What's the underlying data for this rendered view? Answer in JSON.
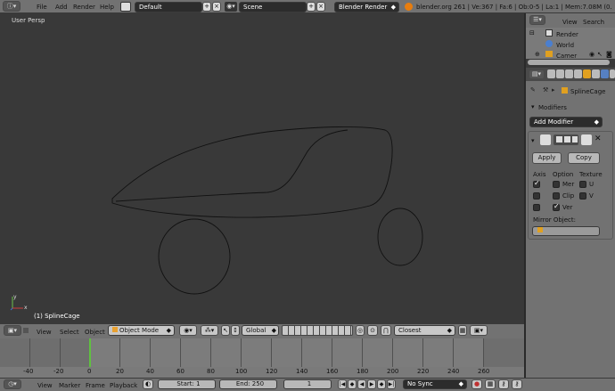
{
  "topbar": {
    "menus": [
      "File",
      "Add",
      "Render",
      "Help"
    ],
    "screen_layout": "Default",
    "scene": "Scene",
    "render_engine": "Blender Render",
    "stats": "blender.org 261 | Ve:367 | Fa:6 | Ob:0-5 | La:1 | Mem:7.08M (0.10M) | Sp"
  },
  "viewport": {
    "view_name": "User Persp",
    "object_label": "(1) SplineCage",
    "axis_y": "y",
    "axis_x": "x"
  },
  "viewport_header": {
    "menus": [
      "View",
      "Select",
      "Object"
    ],
    "mode": "Object Mode",
    "orientation": "Global",
    "snap_target": "Closest"
  },
  "timeline": {
    "ticks": [
      "-40",
      "-20",
      "0",
      "20",
      "40",
      "60",
      "80",
      "100",
      "120",
      "140",
      "160",
      "180",
      "200",
      "220",
      "240",
      "260"
    ],
    "current_frame_marker": 0,
    "menus": [
      "View",
      "Marker",
      "Frame",
      "Playback"
    ],
    "start": "Start: 1",
    "end": "End: 250",
    "current": "1",
    "sync": "No Sync"
  },
  "outliner": {
    "menus": [
      "View",
      "Search"
    ],
    "items": [
      "Render",
      "World",
      "Camer"
    ]
  },
  "properties": {
    "object_name": "SplineCage",
    "modifiers_title": "Modifiers",
    "add_modifier": "Add Modifier",
    "apply": "Apply",
    "copy": "Copy",
    "col_axis": "Axis",
    "col_option": "Option",
    "col_texture": "Texture",
    "opt_merge": "Mer",
    "opt_clip": "Clip",
    "opt_vertex": "Ver",
    "tex_u": "U",
    "tex_v": "V",
    "mirror_object_label": "Mirror Object:",
    "axis_x_checked": true,
    "vertex_checked": true
  }
}
